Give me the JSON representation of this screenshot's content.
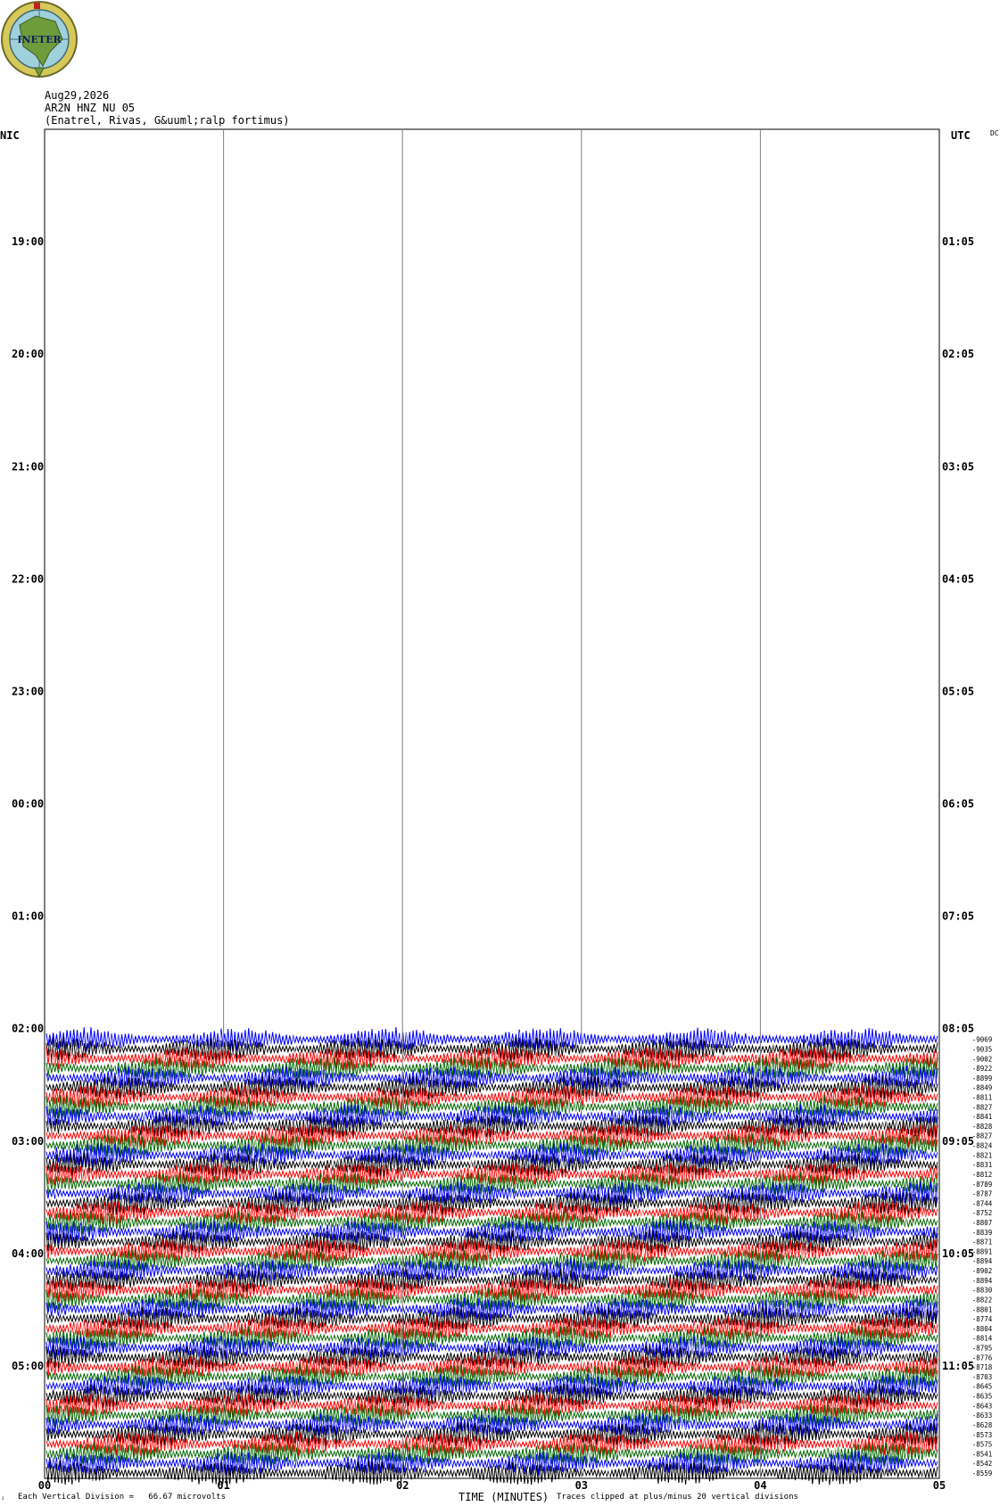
{
  "logo": {
    "text": "INETER"
  },
  "header": {
    "date": "Aug29,2026",
    "station": "AR2N HNZ NU 05",
    "location": "(Enatrel, Rivas, G&uuml;ralp fortimus)"
  },
  "labels": {
    "left_zone": "NIC",
    "right_zone": "UTC",
    "dc": "DC",
    "left_times": [
      "19:00",
      "20:00",
      "21:00",
      "22:00",
      "23:00",
      "00:00",
      "01:00",
      "02:00",
      "03:00",
      "04:00",
      "05:00"
    ],
    "right_times": [
      "01:05",
      "02:05",
      "03:05",
      "04:05",
      "05:05",
      "06:05",
      "07:05",
      "08:05",
      "09:05",
      "10:05",
      "11:05"
    ],
    "footer_scale": "Each Vertical Division =   66.67 microvolts",
    "footer_clip": "Traces clipped at plus/minus 20 vertical divisions",
    "corner_mark": "ᴊ"
  },
  "colors": {
    "trace_cycle": [
      "#0000ff",
      "#000000",
      "#ff0000",
      "#006600"
    ],
    "grid": "#808080",
    "clipped_white": "#ffffff"
  },
  "chart_data": {
    "type": "line",
    "xlabel": "TIME (MINUTES)",
    "x_ticks": [
      "00",
      "01",
      "02",
      "03",
      "04",
      "05"
    ],
    "xlim": [
      0,
      5
    ],
    "hour_rows_total": 12,
    "first_data_hour_index": 8,
    "trace_offsets": [
      -9069,
      -9035,
      -9002,
      -8922,
      -8899,
      -8849,
      -8811,
      -8827,
      -8841,
      -8828,
      -8827,
      -8824,
      -8821,
      -8831,
      -8812,
      -8789,
      -8787,
      -8744,
      -8752,
      -8807,
      -8839,
      -8871,
      -8891,
      -8894,
      -8902,
      -8894,
      -8830,
      -8822,
      -8801,
      -8774,
      -8804,
      -8814,
      -8795,
      -8776,
      -8718,
      -8703,
      -8645,
      -8635,
      -8643,
      -8633,
      -8628,
      -8573,
      -8575,
      -8541,
      -8542,
      -8559
    ]
  }
}
